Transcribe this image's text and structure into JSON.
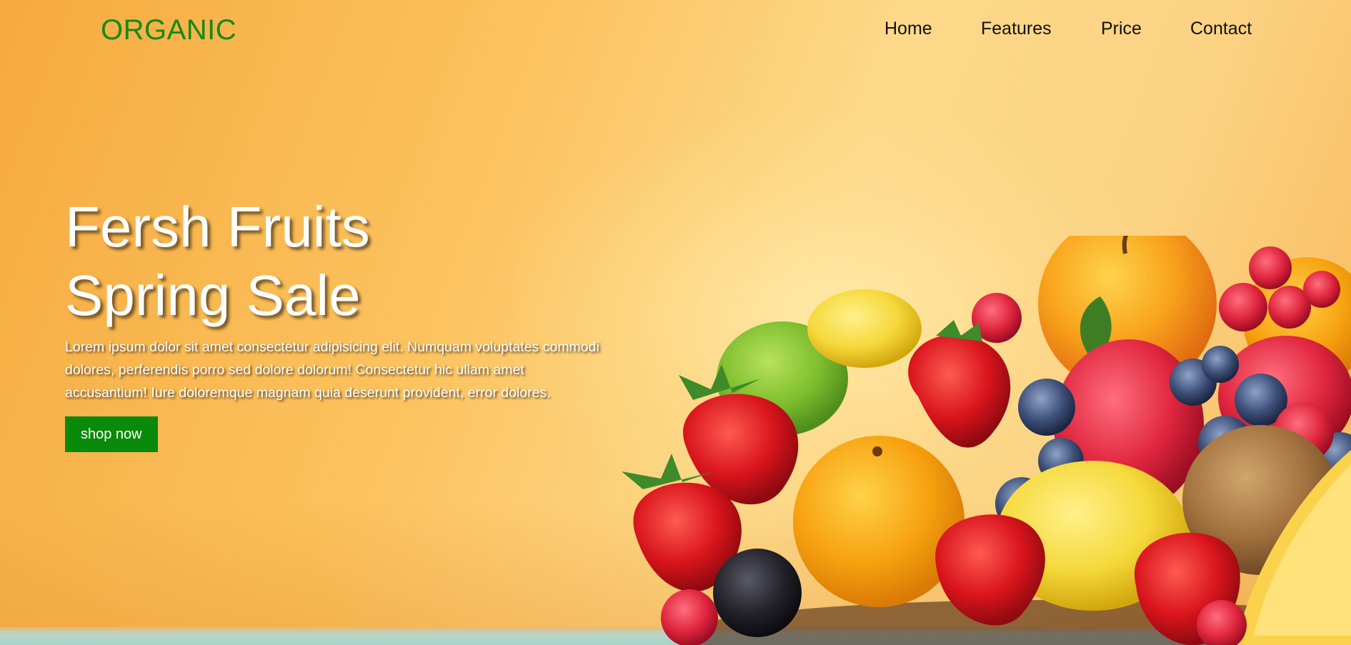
{
  "brand": {
    "logo": "ORGANIC",
    "color": "#138a13"
  },
  "nav": {
    "links": [
      {
        "label": "Home"
      },
      {
        "label": "Features"
      },
      {
        "label": "Price"
      },
      {
        "label": "Contact"
      }
    ]
  },
  "hero": {
    "title_line1": "Fersh Fruits",
    "title_line2": "Spring Sale",
    "text": "Lorem ipsum dolor sit amet consectetur adipisicing elit. Numquam voluptates commodi dolores, perferendis porro sed dolore dolorum! Consectetur hic ullam amet accusantium! Iure doloremque magnam quia deserunt provident, error dolores.",
    "cta_label": "shop now",
    "cta_color": "#0a8a0a"
  },
  "background": {
    "image": "fresh-fruits-image",
    "accent": "#fcc35f"
  }
}
